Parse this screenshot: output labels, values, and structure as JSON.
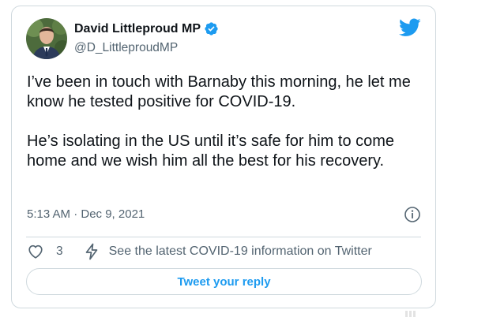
{
  "author": {
    "display_name": "David Littleproud MP",
    "handle": "@D_LittleproudMP"
  },
  "tweet": {
    "paragraphs": [
      "I’ve been in touch with Barnaby this morning, he let me know he tested positive for COVID-19.",
      "He’s isolating in the US until it’s safe for him to come home and we wish him all the best for his recovery."
    ],
    "timestamp": "5:13 AM · Dec 9, 2021"
  },
  "actions": {
    "like_count": "3",
    "covid_info": "See the latest COVID-19 information on Twitter"
  },
  "reply": {
    "label": "Tweet your reply"
  },
  "colors": {
    "accent": "#1d9bf0",
    "text": "#0f1419",
    "secondary": "#536471",
    "border": "#cfd9de"
  },
  "icons": [
    "avatar",
    "verified-badge-icon",
    "twitter-bird-icon",
    "info-icon",
    "heart-icon",
    "lightning-bolt-icon"
  ]
}
